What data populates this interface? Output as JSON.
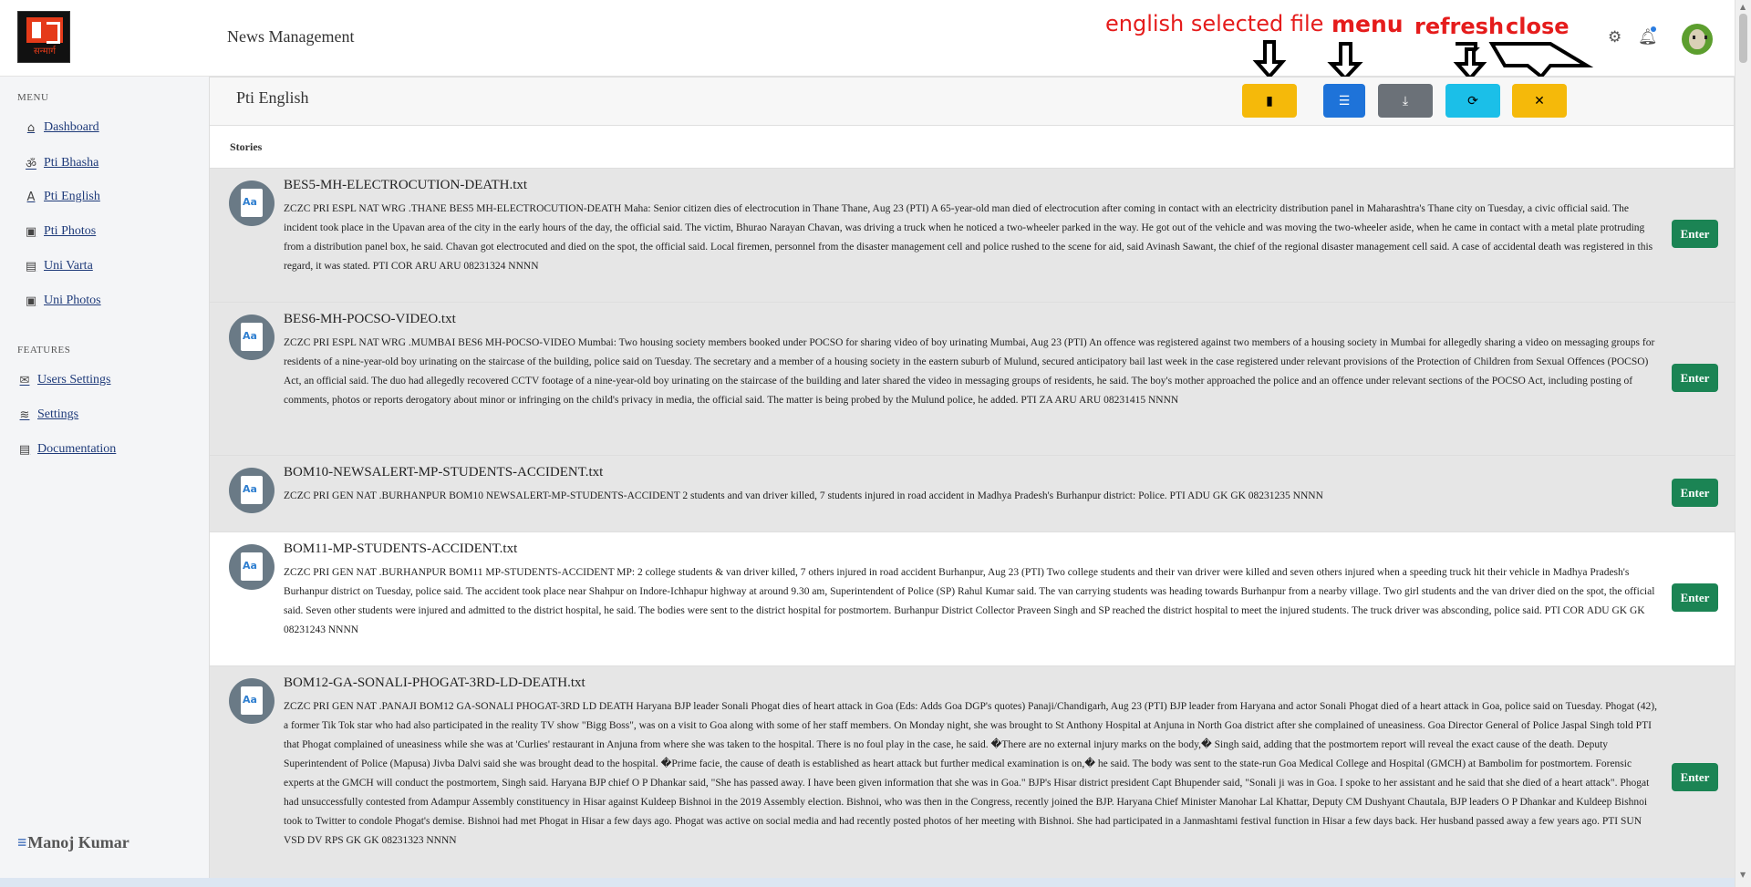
{
  "header": {
    "logo_text": "सन्मार्ग",
    "app_title": "News Management",
    "icons": {
      "settings": "gear-icon",
      "notifications": "bell-icon",
      "avatar": "user-avatar"
    }
  },
  "annotations": {
    "file": "english selected file",
    "menu": "menu",
    "refresh": "refresh",
    "close": "close"
  },
  "sidebar": {
    "menu_heading": "MENU",
    "menu_items": [
      {
        "label": "Dashboard",
        "icon": "home-icon",
        "glyph": "⌂"
      },
      {
        "label": "Pti Bhasha",
        "icon": "om-icon",
        "glyph": "ॐ"
      },
      {
        "label": "Pti English",
        "icon": "letter-a-icon",
        "glyph": "A"
      },
      {
        "label": "Pti Photos",
        "icon": "image-icon",
        "glyph": "▣"
      },
      {
        "label": "Uni Varta",
        "icon": "document-icon",
        "glyph": "▤"
      },
      {
        "label": "Uni Photos",
        "icon": "image-icon",
        "glyph": "▣"
      }
    ],
    "features_heading": "FEATURES",
    "feature_items": [
      {
        "label": "Users Settings",
        "icon": "envelope-icon",
        "glyph": "✉"
      },
      {
        "label": "Settings",
        "icon": "layers-icon",
        "glyph": "≋"
      },
      {
        "label": "Documentation",
        "icon": "file-icon",
        "glyph": "▤"
      }
    ],
    "user_name": "Manoj Kumar",
    "user_glyph": "≡"
  },
  "panel": {
    "title": "Pti English",
    "stories_label": "Stories",
    "toolbar": {
      "file_glyph": "▮",
      "menu_glyph": "☰",
      "download_glyph": "⤓",
      "refresh_glyph": "⟳",
      "close_glyph": "✕"
    },
    "enter_label": "Enter",
    "icon_text": "Aa",
    "stories": [
      {
        "file": "BES5-MH-ELECTROCUTION-DEATH.txt",
        "text": "ZCZC PRI ESPL NAT WRG .THANE BES5 MH-ELECTROCUTION-DEATH Maha: Senior citizen dies of electrocution in Thane Thane, Aug 23 (PTI) A 65-year-old man died of electrocution after coming in contact with an electricity distribution panel in Maharashtra's Thane city on Tuesday, a civic official said. The incident took place in the Upavan area of the city in the early hours of the day, the official said. The victim, Bhurao Narayan Chavan, was driving a truck when he noticed a two-wheeler parked in the way. He got out of the vehicle and was moving the two-wheeler aside, when he came in contact with a metal plate protruding from a distribution panel box, he said. Chavan got electrocuted and died on the spot, the official said. Local firemen, personnel from the disaster management cell and police rushed to the scene for aid, said Avinash Sawant, the chief of the regional disaster management cell said. A case of accidental death was registered in this regard, it was stated. PTI COR ARU ARU 08231324 NNNN"
      },
      {
        "file": "BES6-MH-POCSO-VIDEO.txt",
        "text": "ZCZC PRI ESPL NAT WRG .MUMBAI BES6 MH-POCSO-VIDEO Mumbai: Two housing society members booked under POCSO for sharing video of boy urinating Mumbai, Aug 23 (PTI) An offence was registered against two members of a housing society in Mumbai for allegedly sharing a video on messaging groups for residents of a nine-year-old boy urinating on the staircase of the building, police said on Tuesday. The secretary and a member of a housing society in the eastern suburb of Mulund, secured anticipatory bail last week in the case registered under relevant provisions of the Protection of Children from Sexual Offences (POCSO) Act, an official said. The duo had allegedly recovered CCTV footage of a nine-year-old boy urinating on the staircase of the building and later shared the video in messaging groups of residents, he said. The boy's mother approached the police and an offence under relevant sections of the POCSO Act, including posting of comments, photos or reports derogatory about minor or infringing on the child's privacy in media, the official said. The matter is being probed by the Mulund police, he added. PTI ZA ARU ARU 08231415 NNNN"
      },
      {
        "file": "BOM10-NEWSALERT-MP-STUDENTS-ACCIDENT.txt",
        "text": "ZCZC PRI GEN NAT .BURHANPUR BOM10 NEWSALERT-MP-STUDENTS-ACCIDENT 2 students and van driver killed, 7 students injured in road accident in Madhya Pradesh's Burhanpur district: Police. PTI ADU GK GK 08231235 NNNN"
      },
      {
        "file": "BOM11-MP-STUDENTS-ACCIDENT.txt",
        "text": "ZCZC PRI GEN NAT .BURHANPUR BOM11 MP-STUDENTS-ACCIDENT MP: 2 college students & van driver killed, 7 others injured in road accident Burhanpur, Aug 23 (PTI) Two college students and their van driver were killed and seven others injured when a speeding truck hit their vehicle in Madhya Pradesh's Burhanpur district on Tuesday, police said. The accident took place near Shahpur on Indore-Ichhapur highway at around 9.30 am, Superintendent of Police (SP) Rahul Kumar said. The van carrying students was heading towards Burhanpur from a nearby village. Two girl students and the van driver died on the spot, the official said. Seven other students were injured and admitted to the district hospital, he said. The bodies were sent to the district hospital for postmortem. Burhanpur District Collector Praveen Singh and SP reached the district hospital to meet the injured students. The truck driver was absconding, police said. PTI COR ADU GK GK 08231243 NNNN"
      },
      {
        "file": "BOM12-GA-SONALI-PHOGAT-3RD-LD-DEATH.txt",
        "text": "ZCZC PRI GEN NAT .PANAJI BOM12 GA-SONALI PHOGAT-3RD LD DEATH Haryana BJP leader Sonali Phogat dies of heart attack in Goa (Eds: Adds Goa DGP's quotes) Panaji/Chandigarh, Aug 23 (PTI) BJP leader from Haryana and actor Sonali Phogat died of a heart attack in Goa, police said on Tuesday. Phogat (42), a former Tik Tok star who had also participated in the reality TV show \"Bigg Boss\", was on a visit to Goa along with some of her staff members. On Monday night, she was brought to St Anthony Hospital at Anjuna in North Goa district after she complained of uneasiness. Goa Director General of Police Jaspal Singh told PTI that Phogat complained of uneasiness while she was at 'Curlies' restaurant in Anjuna from where she was taken to the hospital. There is no foul play in the case, he said. �There are no external injury marks on the body,� Singh said, adding that the postmortem report will reveal the exact cause of the death. Deputy Superintendent of Police (Mapusa) Jivba Dalvi said she was brought dead to the hospital. �Prime facie, the cause of death is established as heart attack but further medical examination is on,� he said. The body was sent to the state-run Goa Medical College and Hospital (GMCH) at Bambolim for postmortem. Forensic experts at the GMCH will conduct the postmortem, Singh said. Haryana BJP chief O P Dhankar said, \"She has passed away. I have been given information that she was in Goa.\" BJP's Hisar district president Capt Bhupender said, \"Sonali ji was in Goa. I spoke to her assistant and he said that she died of a heart attack\". Phogat had unsuccessfully contested from Adampur Assembly constituency in Hisar against Kuldeep Bishnoi in the 2019 Assembly election. Bishnoi, who was then in the Congress, recently joined the BJP. Haryana Chief Minister Manohar Lal Khattar, Deputy CM Dushyant Chautala, BJP leaders O P Dhankar and Kuldeep Bishnoi took to Twitter to condole Phogat's demise. Bishnoi had met Phogat in Hisar a few days ago. Phogat was active on social media and had recently posted photos of her meeting with Bishnoi. She had participated in a Janmashtami festival function in Hisar a few days back. Her husband passed away a few years ago. PTI SUN VSD DV RPS GK GK 08231323 NNNN"
      }
    ]
  }
}
